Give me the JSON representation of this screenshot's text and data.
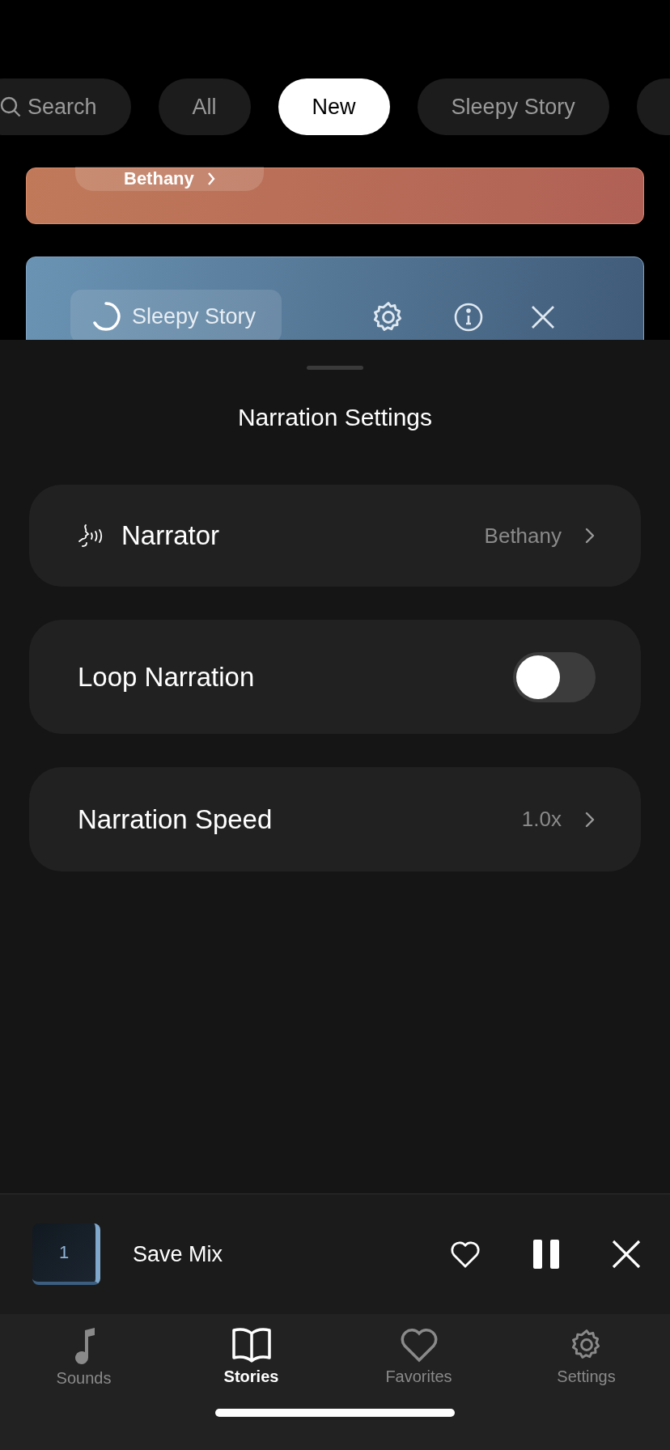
{
  "filters": [
    {
      "kind": "search",
      "label": "Search",
      "selected": false
    },
    {
      "kind": "chip",
      "label": "All",
      "selected": false
    },
    {
      "kind": "chip",
      "label": "New",
      "selected": true
    },
    {
      "kind": "chip",
      "label": "Sleepy Story",
      "selected": false
    }
  ],
  "story_cards": [
    {
      "kind": "narrator",
      "pill": "Bethany"
    },
    {
      "kind": "player",
      "pill": "Sleepy Story"
    }
  ],
  "sheet": {
    "title": "Narration Settings",
    "rows": [
      {
        "kind": "link",
        "label": "Narrator",
        "value": "Bethany",
        "icon": true
      },
      {
        "kind": "toggle",
        "label": "Loop Narration",
        "on": false
      },
      {
        "kind": "link",
        "label": "Narration Speed",
        "value": "1.0x",
        "icon": false
      }
    ]
  },
  "mini_player": {
    "badge": "1",
    "title": "Save Mix"
  },
  "tabs": [
    {
      "label": "Sounds",
      "selected": false
    },
    {
      "label": "Stories",
      "selected": true
    },
    {
      "label": "Favorites",
      "selected": false
    },
    {
      "label": "Settings",
      "selected": false
    }
  ]
}
